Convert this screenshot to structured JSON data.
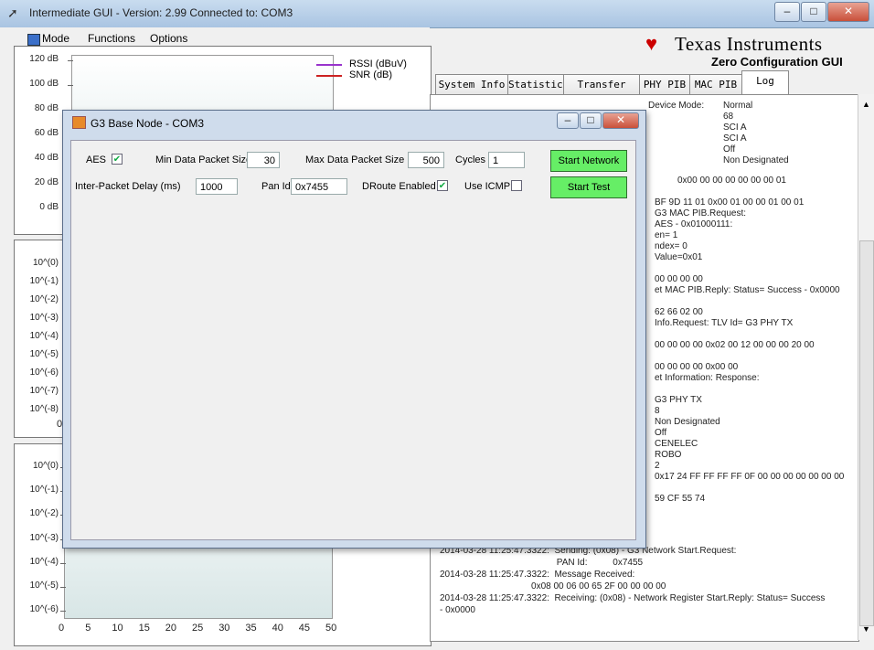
{
  "window": {
    "title": "Intermediate GUI - Version: 2.99   Connected to: COM3"
  },
  "menu": {
    "mode": "Mode",
    "functions": "Functions",
    "options": "Options"
  },
  "brand": {
    "company": "Texas Instruments",
    "subtitle": "Zero Configuration GUI"
  },
  "tabs": [
    "System Info",
    "Statistics",
    "Transfer Info",
    "PHY PIB",
    "MAC PIB",
    "Log"
  ],
  "active_tab": "Log",
  "chart1": {
    "y_ticks": [
      "120 dB",
      "100 dB",
      "80 dB",
      "60 dB",
      "40 dB",
      "20 dB",
      "0 dB"
    ],
    "legend": [
      {
        "name": "RSSI (dBuV)",
        "color": "#9933cc"
      },
      {
        "name": "SNR (dB)",
        "color": "#cc2222"
      }
    ]
  },
  "chart2": {
    "y_ticks": [
      "10^(0)",
      "10^(-1)",
      "10^(-2)",
      "10^(-3)",
      "10^(-4)",
      "10^(-5)",
      "10^(-6)",
      "10^(-7)",
      "10^(-8)"
    ],
    "x_first": "0"
  },
  "chart3": {
    "y_ticks": [
      "10^(0)",
      "10^(-1)",
      "10^(-2)",
      "10^(-3)",
      "10^(-4)",
      "10^(-5)",
      "10^(-6)"
    ],
    "x_ticks": [
      "0",
      "5",
      "10",
      "15",
      "20",
      "25",
      "30",
      "35",
      "40",
      "45",
      "50"
    ]
  },
  "dialog": {
    "title": "G3 Base Node - COM3",
    "aes_label": "AES",
    "aes_checked": true,
    "min_packet_label": "Min Data Packet Size",
    "min_packet_value": "30",
    "max_packet_label": "Max Data Packet Size",
    "max_packet_value": "500",
    "cycles_label": "Cycles",
    "cycles_value": "1",
    "delay_label": "Inter-Packet Delay (ms)",
    "delay_value": "1000",
    "panid_label": "Pan Id",
    "panid_value": "0x7455",
    "droute_label": "DRoute Enabled",
    "droute_checked": true,
    "icmp_label": "Use ICMP",
    "icmp_checked": false,
    "start_network": "Start Network",
    "start_test": "Start Test"
  },
  "log_right_top": [
    "Device Mode:",
    "Normal",
    "68",
    "SCI A",
    "SCI A",
    "Off",
    "Non Designated",
    "0x00 00 00 00 00 00 00 01"
  ],
  "log_lines": [
    "BF 9D 11 01          0x00 01 00 00 01 00 01",
    " G3 MAC PIB.Request:",
    "AES - 0x01000111:",
    "en= 1",
    "ndex= 0",
    "Value=0x01",
    "",
    "00 00 00 00",
    "et MAC PIB.Reply: Status= Success - 0x0000",
    "",
    "62 66 02 00",
    " Info.Request: TLV Id= G3 PHY TX",
    "",
    "00 00 00 00          0x02 00 12 00 00 00 20 00",
    "",
    "00 00 00 00          0x00 00",
    "et Information: Response:",
    "",
    "G3 PHY TX",
    "8",
    "Non Designated",
    "Off",
    "CENELEC",
    "ROBO",
    "2",
    "0x17 24 FF FF FF FF 0F 00 00 00 00 00 00 00",
    "",
    "59 CF 55 74"
  ],
  "log_bottom": [
    "2014-03-28 11:25:47.3322:  Sending: (0x08) - G3 Network Start.Request:",
    "                                              PAN Id:          0x7455",
    "2014-03-28 11:25:47.3322:  Message Received:",
    "                                    0x08 00 06 00 65 2F 00 00 00 00",
    "2014-03-28 11:25:47.3322:  Receiving: (0x08) - Network Register Start.Reply: Status= Success",
    "- 0x0000"
  ],
  "colors": {
    "start_button": "#66ee66",
    "plot_bg": "#d8e6e6"
  }
}
